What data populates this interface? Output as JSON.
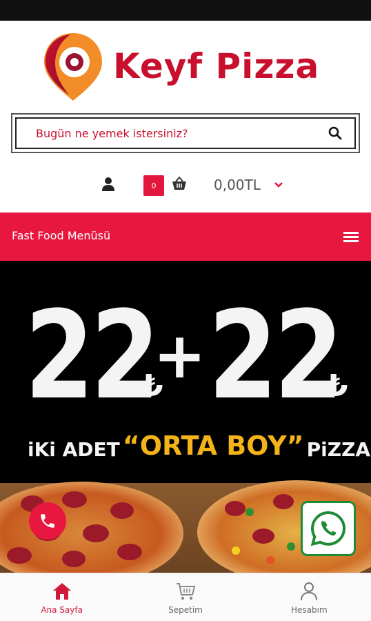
{
  "brand": {
    "name": "Keyf Pizza",
    "color": "#c8102e",
    "accent": "#f28c28"
  },
  "search": {
    "placeholder": "Bugün ne yemek istersiniz?"
  },
  "user_bar": {
    "cart_count": "0",
    "cart_total": "0,00TL"
  },
  "menu_bar": {
    "title": "Fast Food Menüsü",
    "color": "#e8173f"
  },
  "banner": {
    "price_left": "22",
    "plus": "+",
    "price_right": "22",
    "currency": "₺",
    "line_prefix": "iKi ADET",
    "line_highlight": "“ORTA BOY”",
    "line_suffix": "PiZZA"
  },
  "floating": {
    "call_icon": "phone-icon",
    "whatsapp_icon": "whatsapp-icon"
  },
  "bottom_nav": [
    {
      "label": "Ana Sayfa",
      "icon": "home-icon",
      "active": true
    },
    {
      "label": "Sepetim",
      "icon": "cart-icon",
      "active": false
    },
    {
      "label": "Hesabım",
      "icon": "user-icon",
      "active": false
    }
  ]
}
